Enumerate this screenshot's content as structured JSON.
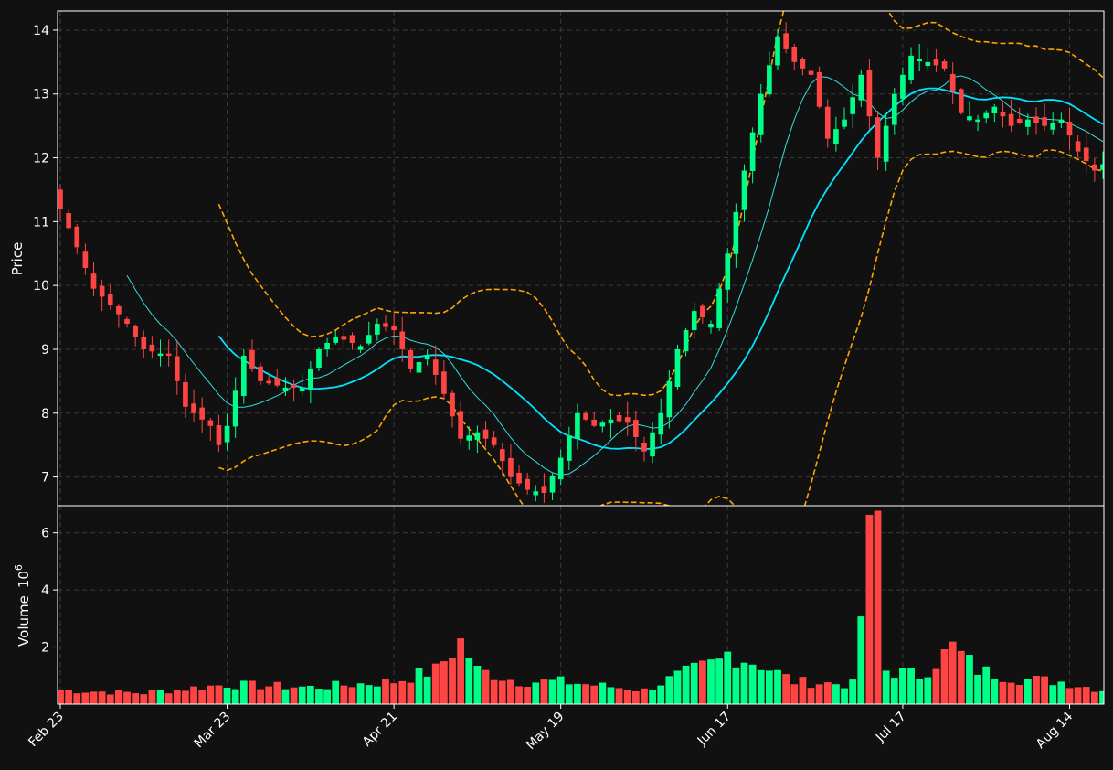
{
  "chart_data": {
    "type": "candlestick",
    "colors": {
      "background": "#111111",
      "up": "#00ff88",
      "down": "#ff4444",
      "grid": "#3a3a3a",
      "axis": "#ffffff",
      "ma_fast": "#33dddd",
      "ma_slow": "#00e5ff",
      "band": "#ffa500"
    },
    "price_panel": {
      "ylabel": "Price",
      "yticks": [
        "7",
        "8",
        "9",
        "10",
        "11",
        "12",
        "13",
        "14"
      ],
      "ylim": [
        6.55,
        14.3
      ]
    },
    "volume_panel": {
      "ylabel": "Volume",
      "ylabel_multiplier": "10",
      "ylabel_exponent": "6",
      "yticks": [
        "2",
        "4",
        "6"
      ],
      "ylim": [
        0,
        6.95
      ]
    },
    "xticks": [
      {
        "label": "Feb 23",
        "index": 0
      },
      {
        "label": "Mar 23",
        "index": 20
      },
      {
        "label": "Apr 21",
        "index": 40
      },
      {
        "label": "May 19",
        "index": 60
      },
      {
        "label": "Jun 17",
        "index": 80
      },
      {
        "label": "Jul 17",
        "index": 101
      },
      {
        "label": "Aug 14",
        "index": 121
      }
    ],
    "n_candles": 126,
    "anchors": [
      [
        0,
        11.2
      ],
      [
        2,
        10.6
      ],
      [
        4,
        9.95
      ],
      [
        6,
        9.7
      ],
      [
        8,
        9.4
      ],
      [
        10,
        9.0
      ],
      [
        13,
        8.9
      ],
      [
        15,
        8.1
      ],
      [
        18,
        7.8
      ],
      [
        19,
        7.5
      ],
      [
        20,
        7.8
      ],
      [
        22,
        8.9
      ],
      [
        24,
        8.5
      ],
      [
        27,
        8.4
      ],
      [
        29,
        8.4
      ],
      [
        31,
        9.0
      ],
      [
        33,
        9.2
      ],
      [
        36,
        9.05
      ],
      [
        38,
        9.4
      ],
      [
        40,
        9.3
      ],
      [
        42,
        8.7
      ],
      [
        44,
        8.9
      ],
      [
        46,
        8.3
      ],
      [
        48,
        7.6
      ],
      [
        50,
        7.7
      ],
      [
        52,
        7.5
      ],
      [
        54,
        7.0
      ],
      [
        56,
        6.8
      ],
      [
        58,
        6.75
      ],
      [
        60,
        7.3
      ],
      [
        62,
        8.0
      ],
      [
        64,
        7.8
      ],
      [
        66,
        7.9
      ],
      [
        68,
        7.85
      ],
      [
        70,
        7.4
      ],
      [
        72,
        8.0
      ],
      [
        74,
        9.0
      ],
      [
        76,
        9.6
      ],
      [
        78,
        9.4
      ],
      [
        80,
        10.5
      ],
      [
        82,
        11.8
      ],
      [
        84,
        13.0
      ],
      [
        86,
        13.9
      ],
      [
        88,
        13.5
      ],
      [
        90,
        13.3
      ],
      [
        92,
        12.3
      ],
      [
        94,
        12.6
      ],
      [
        96,
        13.3
      ],
      [
        98,
        12.0
      ],
      [
        100,
        13.0
      ],
      [
        102,
        13.6
      ],
      [
        104,
        13.5
      ],
      [
        106,
        13.4
      ],
      [
        108,
        12.7
      ],
      [
        110,
        12.6
      ],
      [
        112,
        12.8
      ],
      [
        114,
        12.5
      ],
      [
        116,
        12.6
      ],
      [
        118,
        12.5
      ],
      [
        120,
        12.6
      ],
      [
        122,
        12.1
      ],
      [
        124,
        11.8
      ],
      [
        125,
        11.9
      ]
    ],
    "volume_anchors": [
      [
        0,
        0.5
      ],
      [
        10,
        0.4
      ],
      [
        20,
        0.7
      ],
      [
        30,
        0.6
      ],
      [
        40,
        0.8
      ],
      [
        45,
        1.2
      ],
      [
        48,
        2.2
      ],
      [
        50,
        1.2
      ],
      [
        55,
        0.8
      ],
      [
        60,
        0.8
      ],
      [
        70,
        0.5
      ],
      [
        74,
        1.0
      ],
      [
        79,
        1.5
      ],
      [
        80,
        1.8
      ],
      [
        84,
        1.4
      ],
      [
        88,
        0.8
      ],
      [
        95,
        0.7
      ],
      [
        97,
        5.6
      ],
      [
        98,
        6.5
      ],
      [
        99,
        1.2
      ],
      [
        103,
        1.0
      ],
      [
        107,
        2.0
      ],
      [
        110,
        1.2
      ],
      [
        115,
        0.9
      ],
      [
        120,
        0.8
      ],
      [
        125,
        0.5
      ]
    ],
    "ma_fast_period": 9,
    "ma_slow_period": 20
  }
}
